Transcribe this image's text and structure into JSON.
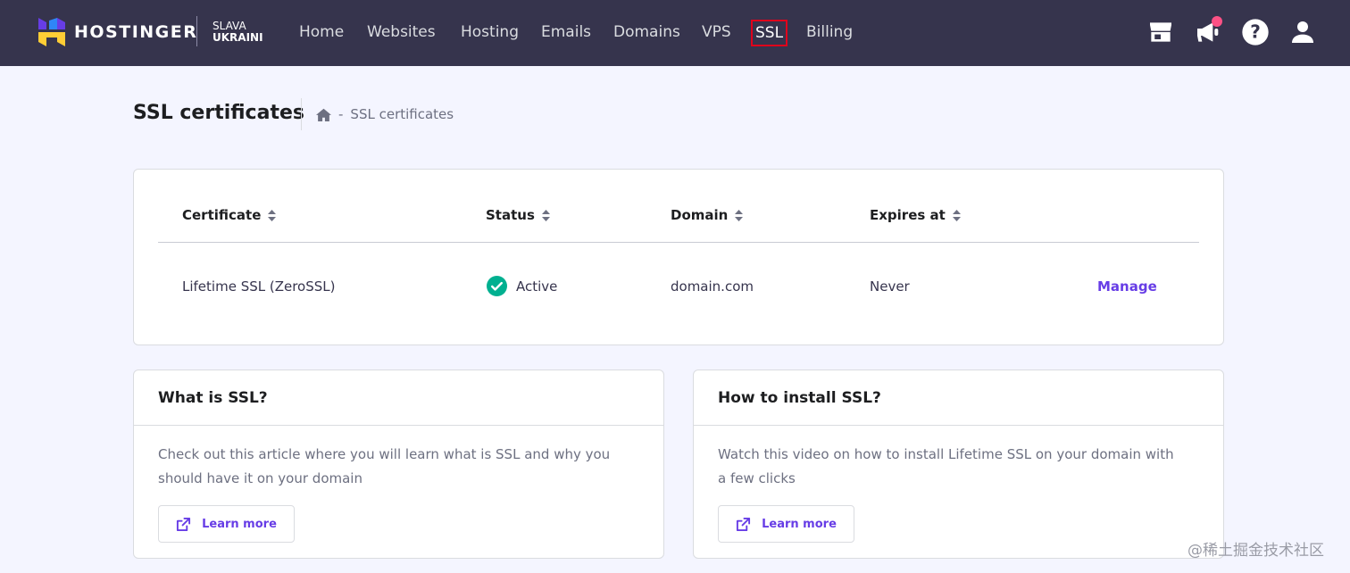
{
  "brand": {
    "logo_text": "HOSTINGER",
    "slava_line1": "SLAVA",
    "slava_line2": "UKRAINI",
    "colors": {
      "nav_bg": "#36344d",
      "accent": "#673de6",
      "active_outline": "#e0001b",
      "success": "#00b090",
      "page_bg": "#f4f5ff"
    }
  },
  "nav": {
    "items": [
      {
        "label": "Home"
      },
      {
        "label": "Websites"
      },
      {
        "label": "Hosting"
      },
      {
        "label": "Emails"
      },
      {
        "label": "Domains"
      },
      {
        "label": "VPS"
      },
      {
        "label": "SSL",
        "active": true
      },
      {
        "label": "Billing"
      }
    ],
    "icons": [
      "store-icon",
      "megaphone-icon",
      "help-icon",
      "user-icon"
    ]
  },
  "header": {
    "title": "SSL certificates",
    "breadcrumb": {
      "home_icon": "home-icon",
      "separator": "-",
      "current": "SSL certificates"
    }
  },
  "table": {
    "columns": [
      "Certificate",
      "Status",
      "Domain",
      "Expires at"
    ],
    "rows": [
      {
        "certificate": "Lifetime SSL (ZeroSSL)",
        "status": "Active",
        "status_icon": "check-circle-icon",
        "domain": "domain.com",
        "expires": "Never",
        "action": "Manage"
      }
    ]
  },
  "cards": [
    {
      "title": "What is SSL?",
      "body": "Check out this article where you will learn what is SSL and why you should have it on your domain",
      "button": "Learn more",
      "button_icon": "external-link-icon"
    },
    {
      "title": "How to install SSL?",
      "body": "Watch this video on how to install Lifetime SSL on your domain with a few clicks",
      "button": "Learn more",
      "button_icon": "external-link-icon"
    }
  ],
  "watermark": "@稀土掘金技术社区"
}
